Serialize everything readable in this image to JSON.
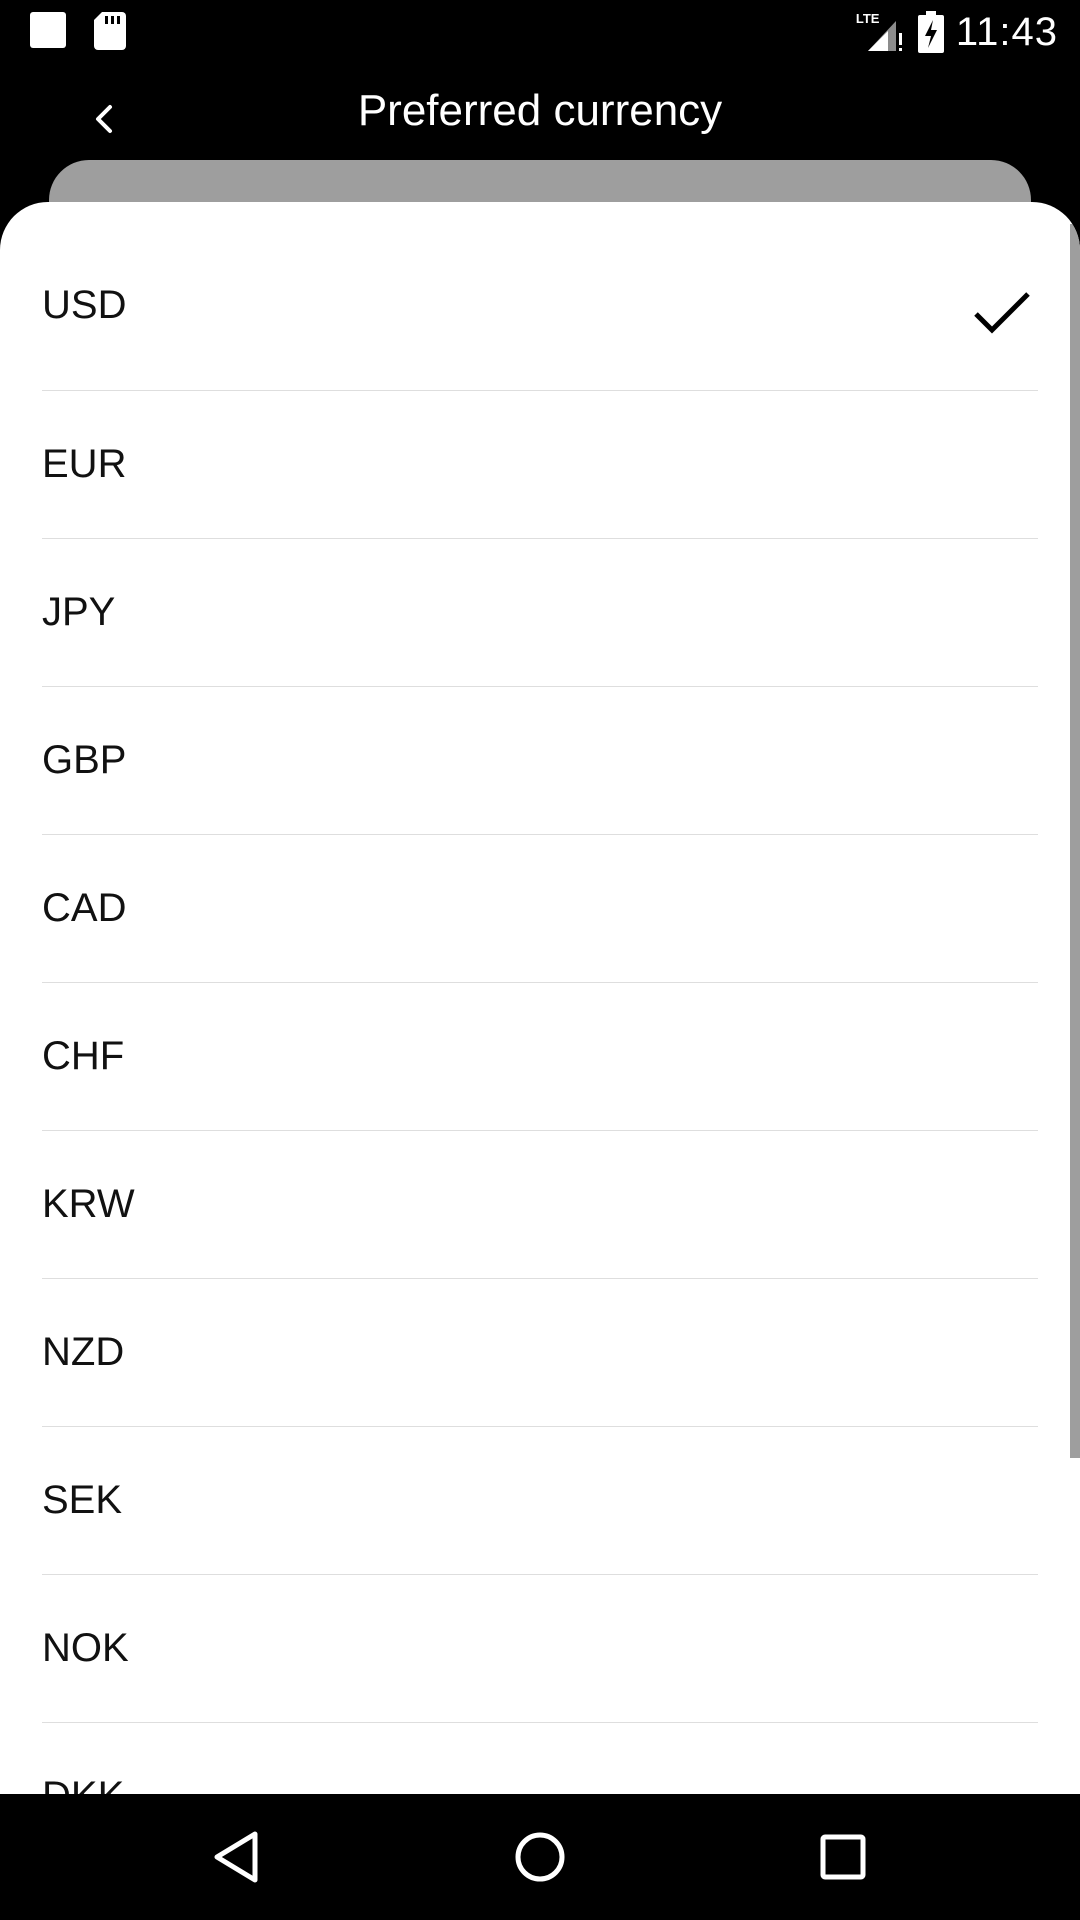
{
  "status_bar": {
    "time": "11:43",
    "network": "LTE",
    "icons": [
      "notification-square-icon",
      "sd-card-icon",
      "signal-icon",
      "battery-charging-icon"
    ]
  },
  "header": {
    "title": "Preferred currency",
    "back_icon": "chevron-left-icon"
  },
  "currency_list": {
    "selected": "USD",
    "items": [
      {
        "code": "USD"
      },
      {
        "code": "EUR"
      },
      {
        "code": "JPY"
      },
      {
        "code": "GBP"
      },
      {
        "code": "CAD"
      },
      {
        "code": "CHF"
      },
      {
        "code": "KRW"
      },
      {
        "code": "NZD"
      },
      {
        "code": "SEK"
      },
      {
        "code": "NOK"
      },
      {
        "code": "DKK"
      }
    ]
  },
  "nav_bar": {
    "icons": [
      "back-triangle-icon",
      "home-circle-icon",
      "recents-square-icon"
    ]
  },
  "colors": {
    "background": "#000000",
    "sheet": "#ffffff",
    "sheet_peek": "#9e9e9e",
    "divider": "#dedede"
  }
}
